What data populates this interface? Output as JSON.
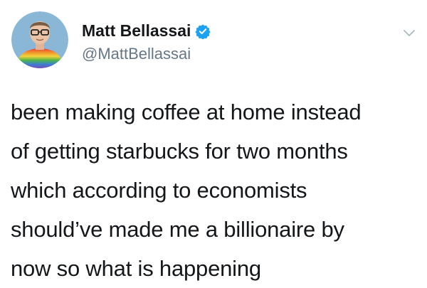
{
  "author": {
    "display_name": "Matt Bellassai",
    "handle": "@MattBellassai",
    "verified": true,
    "verified_color": "#1da1f2"
  },
  "avatar": {
    "icon": "profile-photo",
    "background": "#8ab7d6"
  },
  "menu": {
    "icon": "chevron-down-icon",
    "color": "#aab8c2"
  },
  "tweet": {
    "lines": [
      "been making coffee at home instead",
      "of getting starbucks for two months",
      "which according to economists",
      "should’ve made me a billionaire by",
      "now so what is happening"
    ]
  }
}
